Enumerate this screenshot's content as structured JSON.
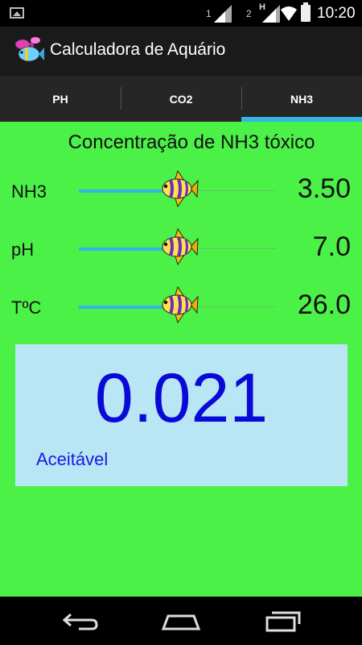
{
  "status_bar": {
    "sim1": "1",
    "sim2": "2",
    "network": "H",
    "time": "10:20"
  },
  "action_bar": {
    "title": "Calculadora de Aquário"
  },
  "tabs": [
    {
      "label": "PH",
      "active": false
    },
    {
      "label": "CO2",
      "active": false
    },
    {
      "label": "NH3",
      "active": true
    }
  ],
  "content": {
    "heading": "Concentração de NH3 tóxico",
    "sliders": [
      {
        "label": "NH3",
        "value": "3.50",
        "fraction": 0.5
      },
      {
        "label": "pH",
        "value": "7.0",
        "fraction": 0.5
      },
      {
        "label": "TºC",
        "value": "26.0",
        "fraction": 0.5
      }
    ],
    "result": {
      "value": "0.021",
      "status": "Aceitável"
    }
  },
  "colors": {
    "content_bg": "#4cf148",
    "accent": "#33b5e5",
    "result_bg": "#b8e6f5",
    "result_text": "#0a0ad8"
  },
  "icons": {
    "slider_thumb": "angelfish-icon",
    "app_logo": "fish-app-icon"
  }
}
